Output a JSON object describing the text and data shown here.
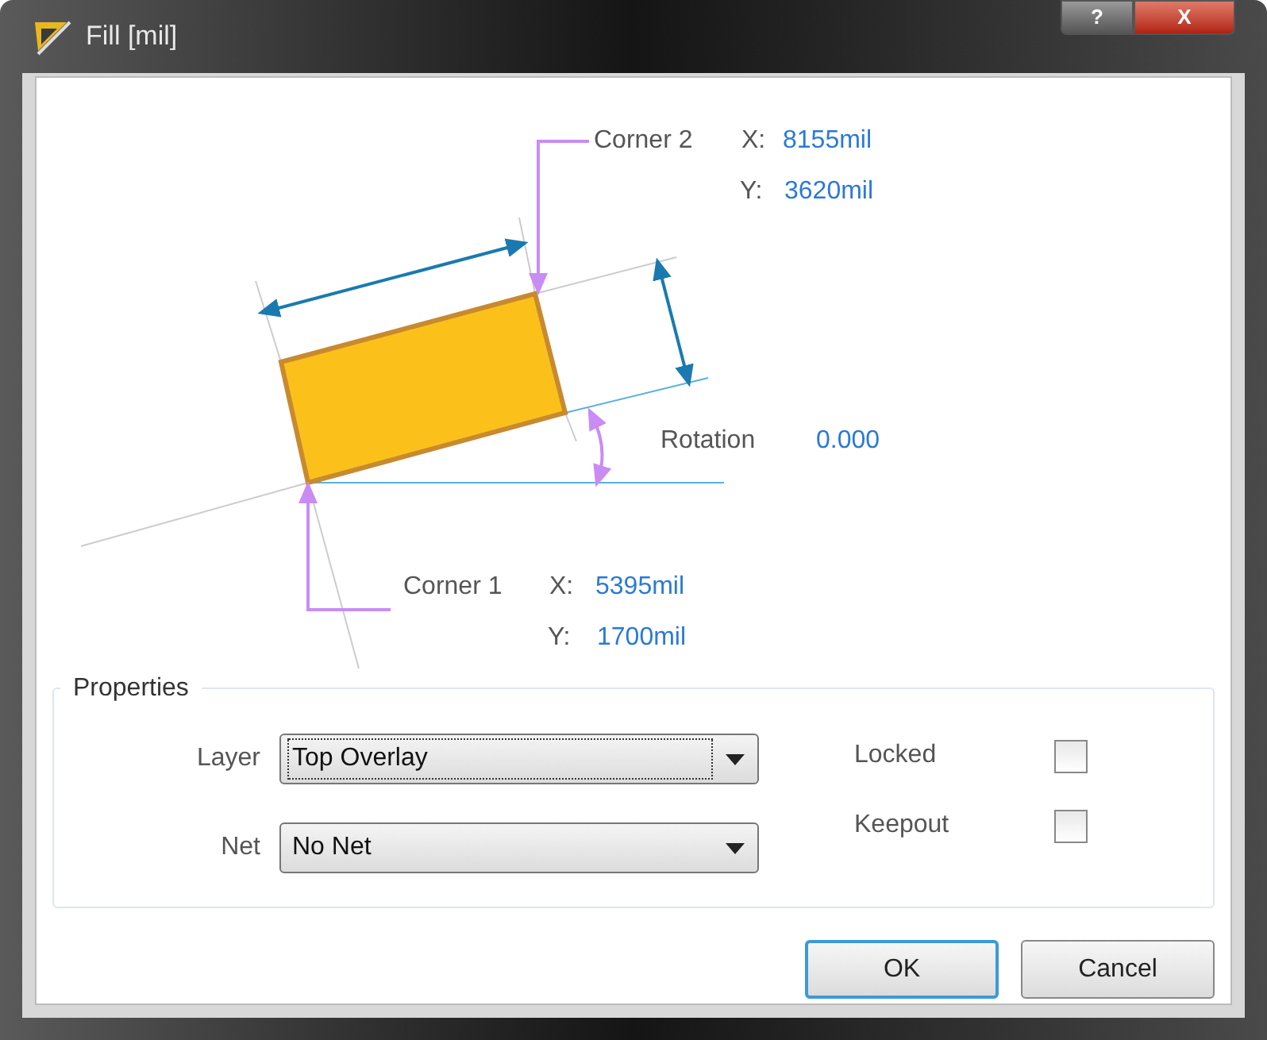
{
  "window": {
    "title": "Fill [mil]",
    "help_button": "?",
    "close_button": "X"
  },
  "diagram": {
    "corner2": {
      "label": "Corner 2",
      "x_label": "X:",
      "x": "8155mil",
      "y_label": "Y:",
      "y": "3620mil"
    },
    "rotation": {
      "label": "Rotation",
      "value": "0.000"
    },
    "corner1": {
      "label": "Corner 1",
      "x_label": "X:",
      "x": "5395mil",
      "y_label": "Y:",
      "y": "1700mil"
    }
  },
  "properties": {
    "title": "Properties",
    "layer": {
      "label": "Layer",
      "value": "Top Overlay",
      "focused": true
    },
    "net": {
      "label": "Net",
      "value": "No Net",
      "focused": false
    },
    "locked": {
      "label": "Locked",
      "checked": false
    },
    "keepout": {
      "label": "Keepout",
      "checked": false
    }
  },
  "buttons": [
    {
      "label": "OK",
      "default": true
    },
    {
      "label": "Cancel",
      "default": false
    }
  ]
}
